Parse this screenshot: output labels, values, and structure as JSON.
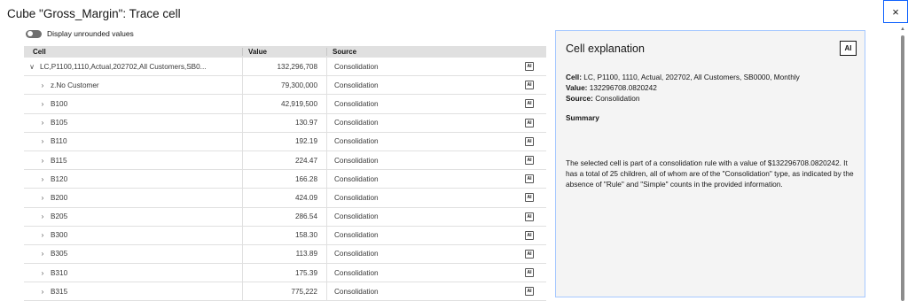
{
  "title": "Cube \"Gross_Margin\": Trace cell",
  "close_icon": "×",
  "toggle_label": "Display unrounded values",
  "grid": {
    "headers": {
      "cell": "Cell",
      "value": "Value",
      "source": "Source"
    },
    "ai_icon": "AI",
    "rows": [
      {
        "chevron": "∨",
        "cell": "LC,P1100,1110,Actual,202702,All Customers,SB0...",
        "value": "132,296,708",
        "source": "Consolidation"
      },
      {
        "chevron": "›",
        "cell": "z.No Customer",
        "value": "79,300,000",
        "source": "Consolidation"
      },
      {
        "chevron": "›",
        "cell": "B100",
        "value": "42,919,500",
        "source": "Consolidation"
      },
      {
        "chevron": "›",
        "cell": "B105",
        "value": "130.97",
        "source": "Consolidation"
      },
      {
        "chevron": "›",
        "cell": "B110",
        "value": "192.19",
        "source": "Consolidation"
      },
      {
        "chevron": "›",
        "cell": "B115",
        "value": "224.47",
        "source": "Consolidation"
      },
      {
        "chevron": "›",
        "cell": "B120",
        "value": "166.28",
        "source": "Consolidation"
      },
      {
        "chevron": "›",
        "cell": "B200",
        "value": "424.09",
        "source": "Consolidation"
      },
      {
        "chevron": "›",
        "cell": "B205",
        "value": "286.54",
        "source": "Consolidation"
      },
      {
        "chevron": "›",
        "cell": "B300",
        "value": "158.30",
        "source": "Consolidation"
      },
      {
        "chevron": "›",
        "cell": "B305",
        "value": "113.89",
        "source": "Consolidation"
      },
      {
        "chevron": "›",
        "cell": "B310",
        "value": "175.39",
        "source": "Consolidation"
      },
      {
        "chevron": "›",
        "cell": "B315",
        "value": "775,222",
        "source": "Consolidation"
      }
    ]
  },
  "panel": {
    "heading": "Cell explanation",
    "badge": "AI",
    "cell_label": "Cell:",
    "cell_value": "LC, P1100, 1110, Actual, 202702, All Customers, SB0000, Monthly",
    "value_label": "Value:",
    "value_value": "132296708.0820242",
    "source_label": "Source:",
    "source_value": "Consolidation",
    "summary_heading": "Summary",
    "summary_text": "The selected cell is part of a consolidation rule with a value of $132296708.0820242. It has a total of 25 children, all of whom are of the \"Consolidation\" type, as indicated by the absence of \"Rule\" and \"Simple\" counts in the provided information."
  },
  "scroll_up_icon": "▲"
}
